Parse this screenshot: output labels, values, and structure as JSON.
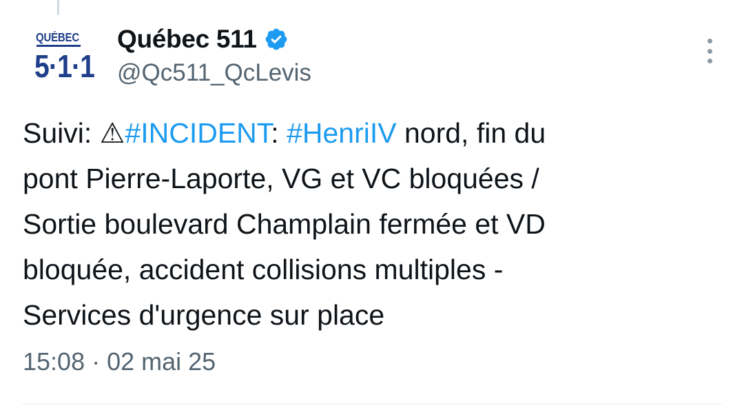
{
  "account": {
    "display_name": "Québec 511",
    "handle": "@Qc511_QcLevis",
    "verified": true,
    "avatar_text_top": "QUÉBEC",
    "avatar_text_bottom": "5·1·1"
  },
  "tweet": {
    "parts": {
      "p1": "Suivi: ⚠",
      "tag1": "#INCIDENT",
      "p2": ": ",
      "tag2": "#HenriIV",
      "p3": " nord, fin du\npont Pierre-Laporte, VG et VC bloquées /\nSortie boulevard Champlain fermée et VD\nbloquée, accident collisions multiples -\nServices d'urgence sur place"
    },
    "timestamp": "15:08 · 02 mai 25"
  },
  "icons": {
    "verified": "verified-badge-icon",
    "more": "more-options-icon"
  },
  "colors": {
    "hashtag": "#1d9bf0",
    "verified": "#1d9bf0",
    "secondary_text": "#536471",
    "avatar_brand": "#1f3f8a"
  }
}
